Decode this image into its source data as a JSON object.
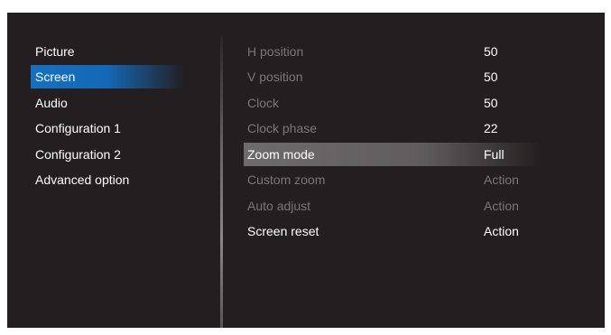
{
  "left_menu": {
    "items": [
      {
        "label": "Picture"
      },
      {
        "label": "Screen"
      },
      {
        "label": "Audio"
      },
      {
        "label": "Configuration 1"
      },
      {
        "label": "Configuration 2"
      },
      {
        "label": "Advanced option"
      }
    ],
    "selected": "Screen"
  },
  "settings": {
    "rows": [
      {
        "label": "H position",
        "value": "50"
      },
      {
        "label": "V position",
        "value": "50"
      },
      {
        "label": "Clock",
        "value": "50"
      },
      {
        "label": "Clock phase",
        "value": "22"
      },
      {
        "label": "Zoom mode",
        "value": "Full"
      },
      {
        "label": "Custom zoom",
        "value": "Action"
      },
      {
        "label": "Auto adjust",
        "value": "Action"
      },
      {
        "label": "Screen reset",
        "value": "Action"
      }
    ],
    "selected": "Zoom mode"
  },
  "colors": {
    "background": "#231f20",
    "menu_highlight": "#1670bf",
    "row_highlight": "#6e6b6c",
    "dim_text": "#7a7778",
    "text": "#ffffff"
  }
}
